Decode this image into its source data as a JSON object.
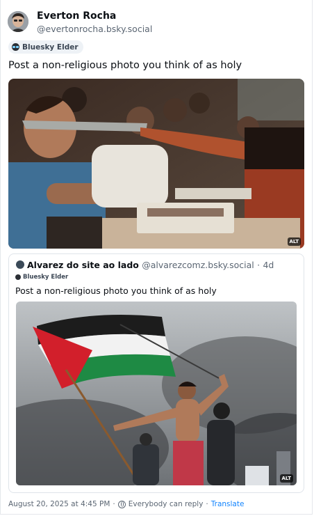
{
  "author": {
    "name": "Everton Rocha",
    "handle": "@evertonrocha.bsky.social",
    "badge": "Bluesky Elder"
  },
  "post": {
    "text": "Post a non-religious photo you think of as holy",
    "image_alt_badge": "ALT"
  },
  "quote": {
    "name": "Alvarez do site ao lado",
    "handle": "@alvarezcomz.bsky.social",
    "age": "4d",
    "badge": "Bluesky Elder",
    "text": "Post a non-religious photo you think of as holy",
    "image_alt_badge": "ALT"
  },
  "footer": {
    "date": "August 20, 2025 at 4:45 PM",
    "reply": "Everybody can reply",
    "translate": "Translate",
    "separator": "·"
  },
  "icons": {
    "badge": "sunglasses-emoji-icon",
    "reply": "globe-icon"
  }
}
